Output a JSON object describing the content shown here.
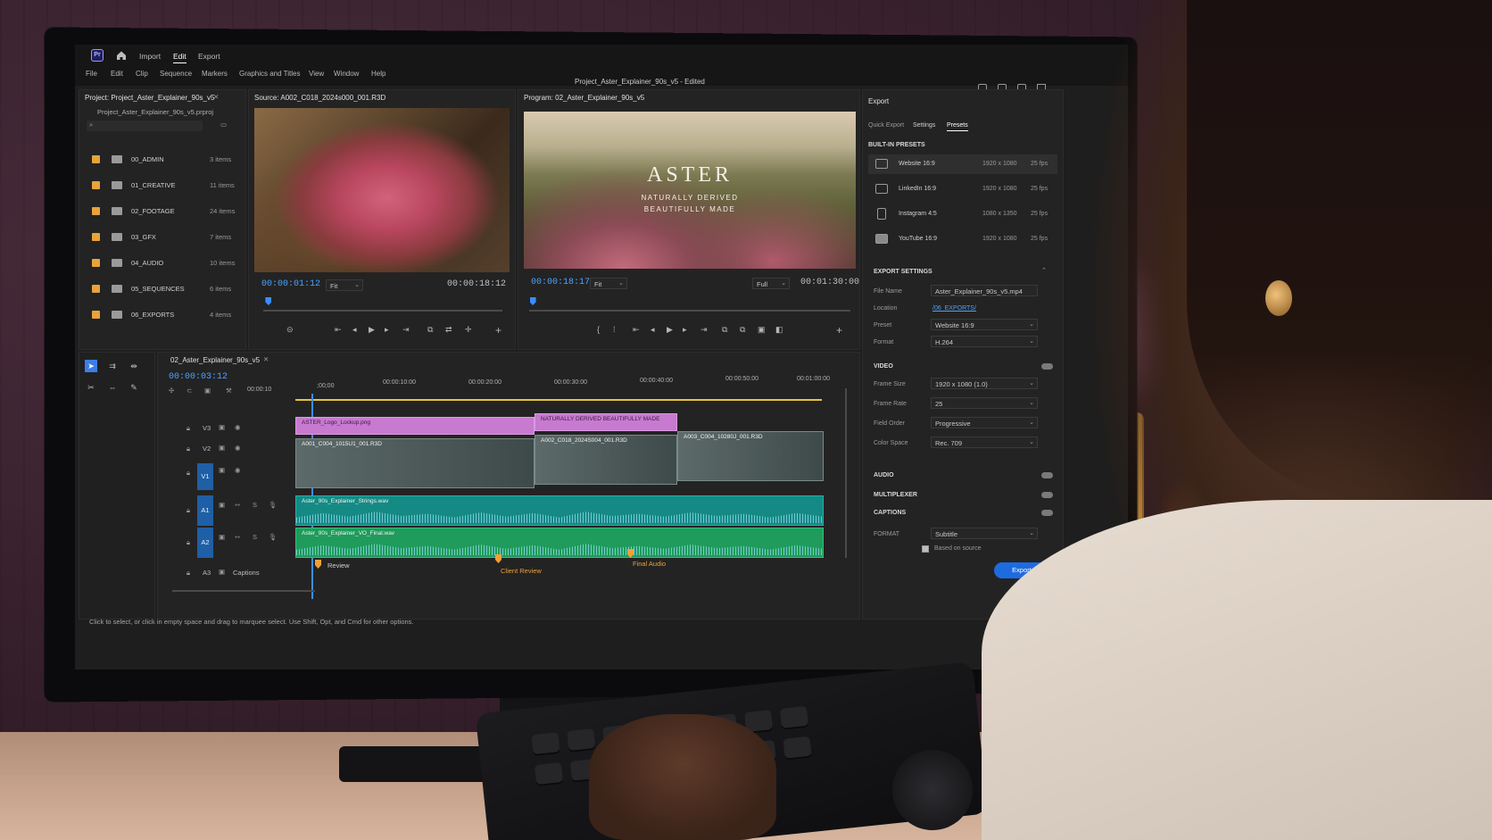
{
  "app": {
    "logo": "Pr",
    "modes": [
      "Import",
      "Edit",
      "Export"
    ],
    "active_mode": "Edit",
    "menus": [
      "File",
      "Edit",
      "Clip",
      "Sequence",
      "Markers",
      "Graphics and Titles",
      "View",
      "Window",
      "Help"
    ],
    "doc_title": "Project_Aster_Explainer_90s_v5 - Edited"
  },
  "project": {
    "title": "Project: Project_Aster_Explainer_90s_v5",
    "file": "Project_Aster_Explainer_90s_v5.prproj",
    "bins": [
      {
        "name": "00_ADMIN",
        "count": "3 items"
      },
      {
        "name": "01_CREATIVE",
        "count": "11 items"
      },
      {
        "name": "02_FOOTAGE",
        "count": "24 items"
      },
      {
        "name": "03_GFX",
        "count": "7 items"
      },
      {
        "name": "04_AUDIO",
        "count": "10 items"
      },
      {
        "name": "05_SEQUENCES",
        "count": "6 items"
      },
      {
        "name": "06_EXPORTS",
        "count": "4 items"
      }
    ]
  },
  "source": {
    "title": "Source: A002_C018_2024s000_001.R3D",
    "timecode": "00:00:01:12",
    "fit": "Fit",
    "duration": "00:00:18:12",
    "playhead": 0.02
  },
  "program": {
    "title": "Program: 02_Aster_Explainer_90s_v5",
    "overlay_title": "ASTER",
    "overlay_line1": "NATURALLY DERIVED",
    "overlay_line2": "BEAUTIFULLY MADE",
    "timecode": "00:00:18:17",
    "fit": "Fit",
    "quality": "Full",
    "duration": "00:01:30:00",
    "playhead": 0.01
  },
  "timeline": {
    "sequence_tab": "02_Aster_Explainer_90s_v5",
    "timecode": "00:00:03:12",
    "ruler": [
      "00:00:10",
      ";00;00",
      "00:00:10:00",
      "00:00:20:00",
      "00:00:30:00",
      "00:00:40:00",
      "00:00:50:00",
      "00:01:00:00"
    ],
    "tracks": {
      "v3": "V3",
      "v2": "V2",
      "v1": "V1",
      "a1": "A1",
      "a2": "A2",
      "a3": "A3",
      "captions": "Captions"
    },
    "track_buttons": {
      "solo": "S"
    },
    "clips": {
      "logo": "ASTER_Logo_Lockup.png",
      "tagline": "NATURALLY DERIVED BEAUTIFULLY MADE",
      "v1_a": "A001_C004_1015U1_001.R3D",
      "v1_b": "A002_C018_2024S004_001.R3D",
      "v1_c": "A003_C004_10280J_001.R3D",
      "a1": "Aster_90s_Explainer_Strings.wav",
      "a2": "Aster_90s_Explainer_VO_Final.wav"
    },
    "markers": [
      "Review",
      "Client Review",
      "Final Audio"
    ]
  },
  "export": {
    "panel_title": "Export",
    "tabs": [
      "Quick Export",
      "Settings",
      "Presets"
    ],
    "active_tab": "Presets",
    "built_in_label": "BUILT-IN PRESETS",
    "presets": [
      {
        "name": "Website 16:9",
        "size": "1920 x 1080",
        "fps": "25 fps"
      },
      {
        "name": "LinkedIn 16:9",
        "size": "1920 x 1080",
        "fps": "25 fps"
      },
      {
        "name": "Instagram 4:5",
        "size": "1080 x 1350",
        "fps": "25 fps"
      },
      {
        "name": "YouTube 16:9",
        "size": "1920 x 1080",
        "fps": "25 fps"
      }
    ],
    "settings_label": "EXPORT SETTINGS",
    "file_name_label": "File Name",
    "file_name": "Aster_Explainer_90s_v5.mp4",
    "location_label": "Location",
    "location": "/06_EXPORTS/",
    "preset_label": "Preset",
    "preset": "Website 16:9",
    "format_label": "Format",
    "format": "H.264",
    "video_label": "VIDEO",
    "frame_size_label": "Frame Size",
    "frame_size": "1920 x 1080 (1.0)",
    "frame_rate_label": "Frame Rate",
    "frame_rate": "25",
    "field_order_label": "Field Order",
    "field_order": "Progressive",
    "color_space_label": "Color Space",
    "color_space": "Rec. 709",
    "audio_label": "AUDIO",
    "multiplexer_label": "MULTIPLEXER",
    "captions_label": "CAPTIONS",
    "caption_format_label": "FORMAT",
    "caption_format": "Subtitle",
    "based_on_source": "Based on source",
    "export_button": "Export"
  },
  "status": "Click to select, or click in empty space and drag to marquee select. Use Shift, Opt, and Cmd for other options.",
  "colors": {
    "accent": "#1e6be0",
    "timecode": "#4aa3ff",
    "bin_label": "#e8a33a",
    "graphics_clip": "#c77ad0",
    "audio_clip": "#158a84"
  }
}
